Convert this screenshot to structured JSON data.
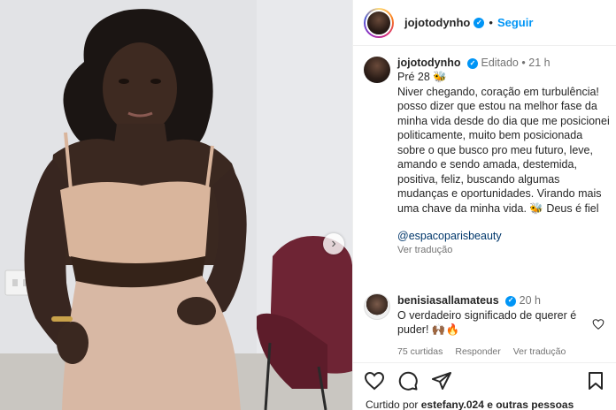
{
  "post": {
    "username": "jojotodynho",
    "follow_label": "Seguir",
    "separator": "•"
  },
  "caption": {
    "username": "jojotodynho",
    "edited_label": "Editado",
    "time": "21 h",
    "paragraph_1": "Pré 28 🐝",
    "paragraph_2": "Niver chegando, coração em turbulência! posso dizer que estou na melhor fase da minha vida desde do dia que me posicionei politicamente, muito bem posicionada sobre o que busco pro meu futuro, leve, amando e sendo amada, destemida, positiva, feliz, buscando algumas mudanças e oportunidades. Virando mais uma chave da minha vida. 🐝 Deus é fiel",
    "mention": "@espacoparisbeauty",
    "see_translation": "Ver tradução"
  },
  "comment": {
    "username": "benisiasallamateus",
    "time": "20 h",
    "text": "O verdadeiro significado de querer é puder! 🙌🏾🔥",
    "likes": "75 curtidas",
    "reply_label": "Responder",
    "see_translation": "Ver tradução"
  },
  "likes_line": {
    "prefix": "Curtido por",
    "user": "estefany.024",
    "suffix": "e outras pessoas"
  },
  "icons": {
    "like": "heart-icon",
    "comment": "comment-icon",
    "share": "paper-plane-icon",
    "save": "bookmark-icon",
    "carousel_next": "chevron-right-icon"
  },
  "colors": {
    "link_blue": "#0095f6",
    "mention_blue": "#00376b",
    "muted_text": "#737373",
    "verified_blue": "#0095f6"
  }
}
